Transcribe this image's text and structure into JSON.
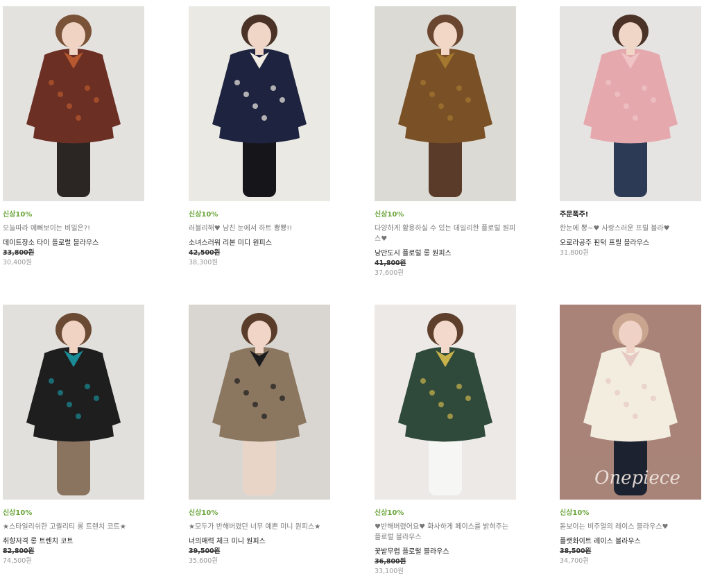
{
  "products": [
    {
      "badge": "신상10%",
      "badge_color": "#6aa53a",
      "description": "오늘따라 예뻐보이는 비밀은?!",
      "name": "데이트장소 타이 플로럴 블라우스",
      "original_price": "33,800원",
      "price": "30,400원",
      "palette": {
        "bg": "#e4e2df",
        "main": "#6b2f24",
        "accent": "#b8582e",
        "lower": "#2b2624",
        "hair": "#7a5238",
        "skin": "#f1d3c4"
      }
    },
    {
      "badge": "신상10%",
      "badge_color": "#6aa53a",
      "description": "러블리해♥ 남친 눈에서 하트 뿅뿅!!",
      "name": "소녀스러워 리본 미디 원피스",
      "original_price": "42,500원",
      "price": "38,300원",
      "palette": {
        "bg": "#ebe9e4",
        "main": "#1e2440",
        "accent": "#f1ede3",
        "lower": "#15151a",
        "hair": "#4a3326",
        "skin": "#f0d6c7"
      }
    },
    {
      "badge": "신상10%",
      "badge_color": "#6aa53a",
      "description": "다양하게 활용하실 수 있는 데일리한 플로럴 원피스♥",
      "name": "낭만도시 플로럴 롱 원피스",
      "original_price": "41,800원",
      "price": "37,600원",
      "palette": {
        "bg": "#dcdad4",
        "main": "#7a5126",
        "accent": "#a5782f",
        "lower": "#5a3a28",
        "hair": "#6a4630",
        "skin": "#f2d6c6"
      }
    },
    {
      "badge": "주문폭주!",
      "badge_color": "#222222",
      "description": "한눈에 뽕~♥ 사랑스러운 프릴 블라♥",
      "name": "오로라공주 핀턱 프릴 블라우스",
      "original_price": "",
      "price": "31,800원",
      "palette": {
        "bg": "#e6e4e2",
        "main": "#e5a9ad",
        "accent": "#f0c4c5",
        "lower": "#2c3a55",
        "hair": "#4a3326",
        "skin": "#f0d6c7"
      }
    },
    {
      "badge": "신상10%",
      "badge_color": "#6aa53a",
      "description": "★스타일리쉬한 고퀄리티 롱 트렌치 코트★",
      "name": "취향저격 롱 트렌치 코트",
      "original_price": "82,800원",
      "price": "74,500원",
      "palette": {
        "bg": "#e2e0dc",
        "main": "#1e1e1f",
        "accent": "#1a8c95",
        "lower": "#8a7460",
        "hair": "#6b4a34",
        "skin": "#f0d3c3"
      }
    },
    {
      "badge": "신상10%",
      "badge_color": "#6aa53a",
      "description": "★모두가 반해버렸던 너무 예쁜 미니 원피스★",
      "name": "너의매력 체크 미니 원피스",
      "original_price": "39,500원",
      "price": "35,600원",
      "palette": {
        "bg": "#d9d6d1",
        "main": "#8b7660",
        "accent": "#1c1c1e",
        "lower": "#e8d5c8",
        "hair": "#5a3c2a",
        "skin": "#f1d6c8"
      }
    },
    {
      "badge": "신상10%",
      "badge_color": "#6aa53a",
      "description": "♥반해버렸어요♥ 화사하게 페이스를 밝혀주는 플로럴 블라우스",
      "name": "꽃밭무렵 플로럴 블라우스",
      "original_price": "36,800원",
      "price": "33,100원",
      "palette": {
        "bg": "#ece9e6",
        "main": "#2f4a3a",
        "accent": "#c9b24a",
        "lower": "#f6f6f4",
        "hair": "#5e3f2c",
        "skin": "#f3d9cb"
      }
    },
    {
      "badge": "신상10%",
      "badge_color": "#6aa53a",
      "description": "돋보이는 비주얼의 레이스 블라우스♥",
      "name": "플랫화이트 레이스 블라우스",
      "original_price": "38,500원",
      "price": "34,700원",
      "palette": {
        "bg": "#a98378",
        "main": "#f3ede0",
        "accent": "#e6c9c2",
        "lower": "#1d2230",
        "hair": "#c9a48e",
        "skin": "#efd2c5"
      },
      "watermark": "Onepiece"
    }
  ]
}
